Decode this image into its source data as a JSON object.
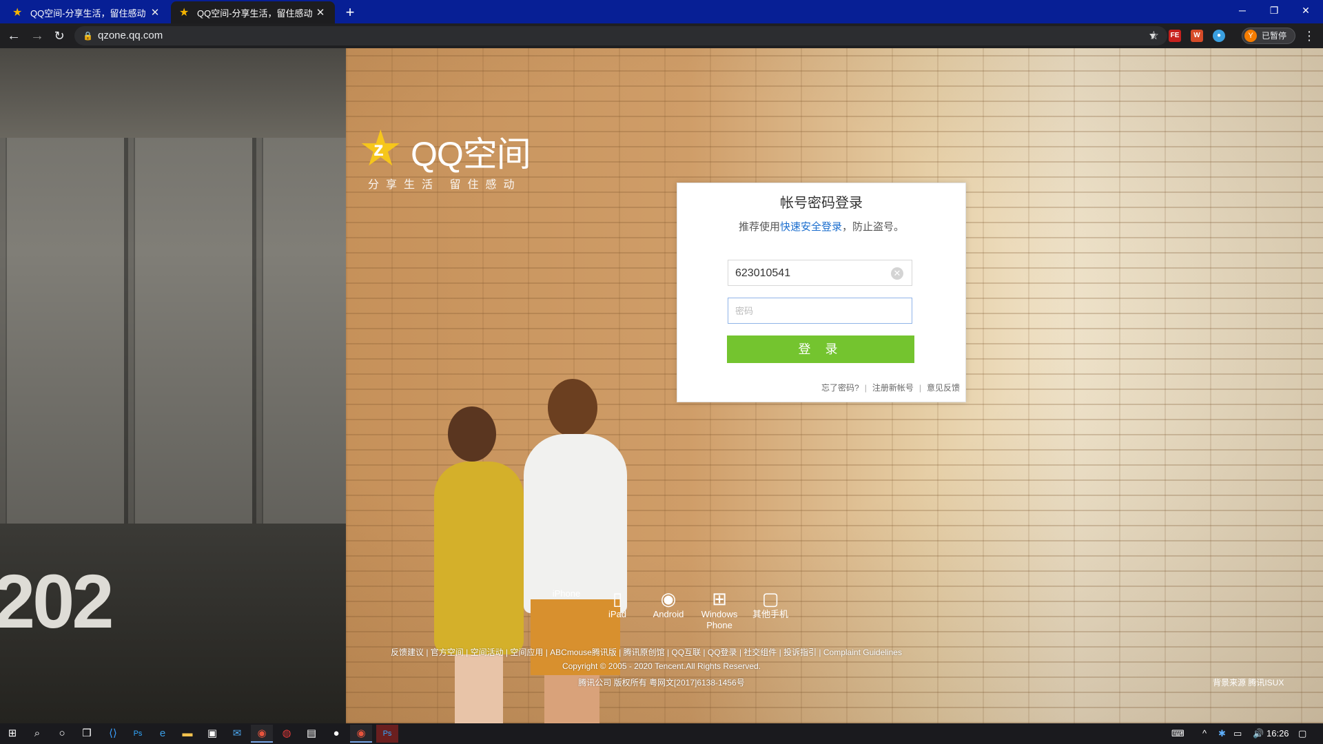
{
  "browser": {
    "tabs": [
      {
        "title": "QQ空间-分享生活，留住感动",
        "active": false
      },
      {
        "title": "QQ空间-分享生活，留住感动",
        "active": true
      }
    ],
    "new_tab_label": "+",
    "url": "qzone.qq.com",
    "profile_initial": "Y",
    "profile_status": "已暂停",
    "window_controls": {
      "minimize": "─",
      "restore": "❐",
      "close": "✕"
    }
  },
  "logo": {
    "name": "QQ空间",
    "slogan": "分享生活    留住感动"
  },
  "login": {
    "title": "帐号密码登录",
    "tip_prefix": "推荐使用",
    "tip_link": "快速安全登录",
    "tip_suffix": "，防止盗号。",
    "username_value": "623010541",
    "password_placeholder": "密码",
    "submit_label": "登 录",
    "forgot_password": "忘了密码?",
    "register": "注册新帐号",
    "feedback": "意见反馈"
  },
  "apps": [
    {
      "label": "iPhone",
      "icon": "apple-icon"
    },
    {
      "label": "iPad",
      "icon": "tablet-icon"
    },
    {
      "label": "Android",
      "icon": "android-icon"
    },
    {
      "label": "Windows Phone",
      "icon": "windows-icon"
    },
    {
      "label": "其他手机",
      "icon": "phone-icon"
    }
  ],
  "footer": {
    "links": "反馈建议 | 官方空间 | 空间活动 | 空间应用 | ABCmouse腾讯版 | 腾讯原创馆 | QQ互联 | QQ登录 | 社交组件 | 投诉指引 | Complaint Guidelines",
    "copyright": "Copyright © 2005 - 2020 Tencent.All Rights Reserved.",
    "icp": "腾讯公司 版权所有 粤网文[2017]6138-1456号",
    "background_source": "背景来源  腾讯ISUX"
  },
  "taskbar": {
    "time": "16:26"
  }
}
